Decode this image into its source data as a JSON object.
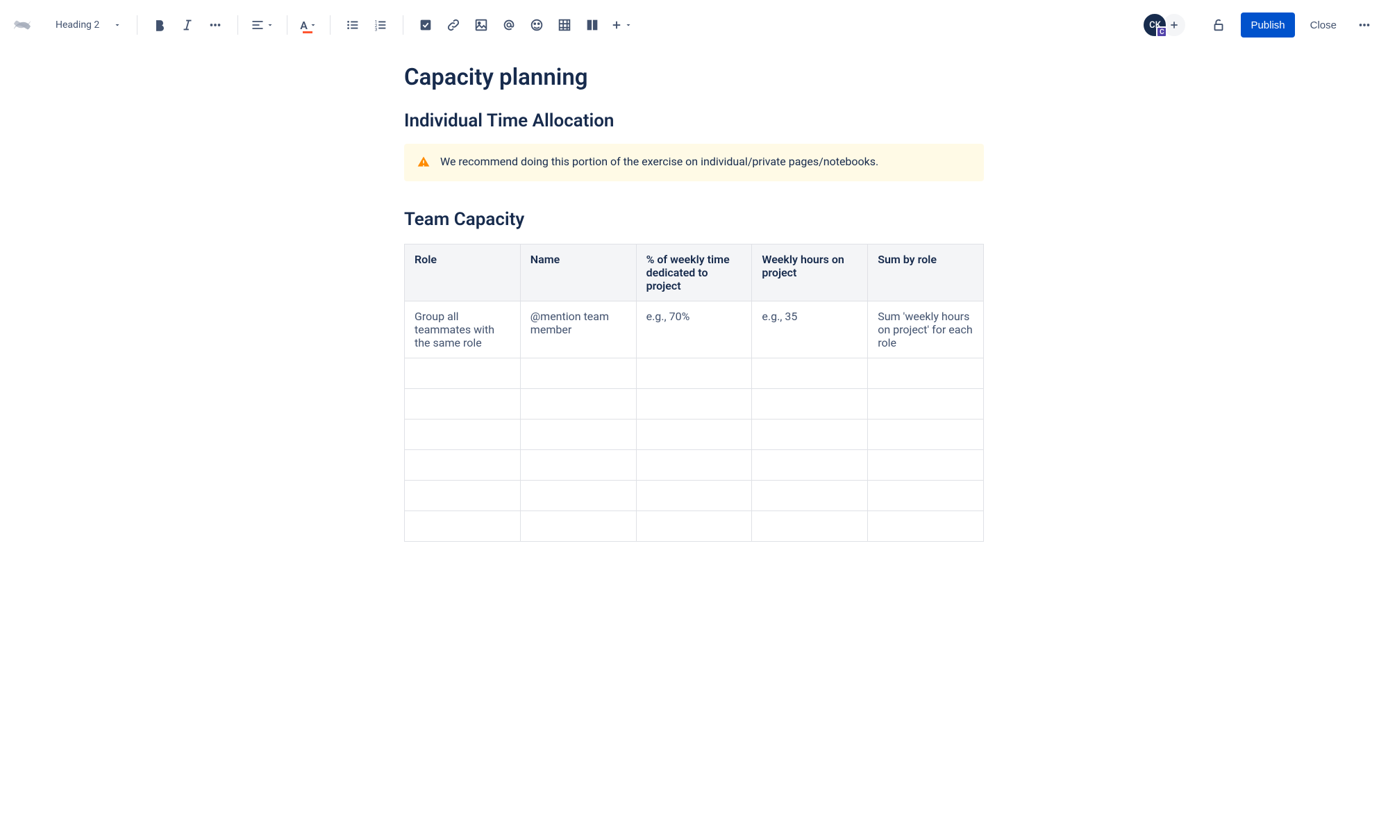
{
  "toolbar": {
    "style_select": "Heading 2",
    "publish_label": "Publish",
    "close_label": "Close"
  },
  "user": {
    "avatar_initials": "CK",
    "avatar_badge": "C"
  },
  "page": {
    "title": "Capacity planning"
  },
  "sections": {
    "individual": {
      "heading": "Individual Time Allocation",
      "panel_text": "We recommend doing this portion of the exercise on individual/private pages/notebooks."
    },
    "team": {
      "heading": "Team Capacity"
    }
  },
  "table": {
    "headers": [
      "Role",
      "Name",
      "% of weekly time dedicated to project",
      "Weekly hours on project",
      "Sum by role"
    ],
    "rows": [
      [
        "Group all teammates with the same role",
        "@mention team member",
        "e.g., 70%",
        "e.g., 35",
        "Sum 'weekly hours on project' for each role"
      ],
      [
        "",
        "",
        "",
        "",
        ""
      ],
      [
        "",
        "",
        "",
        "",
        ""
      ],
      [
        "",
        "",
        "",
        "",
        ""
      ],
      [
        "",
        "",
        "",
        "",
        ""
      ],
      [
        "",
        "",
        "",
        "",
        ""
      ],
      [
        "",
        "",
        "",
        "",
        ""
      ]
    ]
  }
}
